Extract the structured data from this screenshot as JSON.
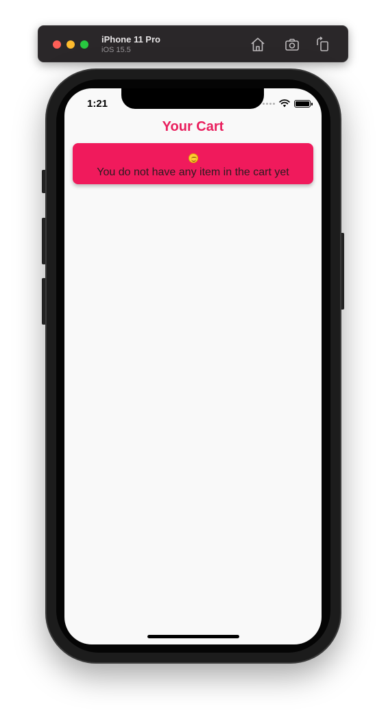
{
  "simulator": {
    "device_name": "iPhone 11 Pro",
    "os_version": "iOS 15.5",
    "toolbar_icons": [
      "home-icon",
      "screenshot-icon",
      "rotate-icon"
    ]
  },
  "status_bar": {
    "time": "1:21",
    "icons": [
      "cellular-icon",
      "wifi-icon",
      "battery-icon"
    ]
  },
  "header": {
    "title": "Your Cart"
  },
  "empty_state": {
    "emoji": "smiling-face-icon",
    "message": "You do not have any item in the cart yet"
  },
  "colors": {
    "accent": "#e91e5d",
    "card_background": "#f01a5c",
    "screen_background": "#f9f9f9"
  }
}
